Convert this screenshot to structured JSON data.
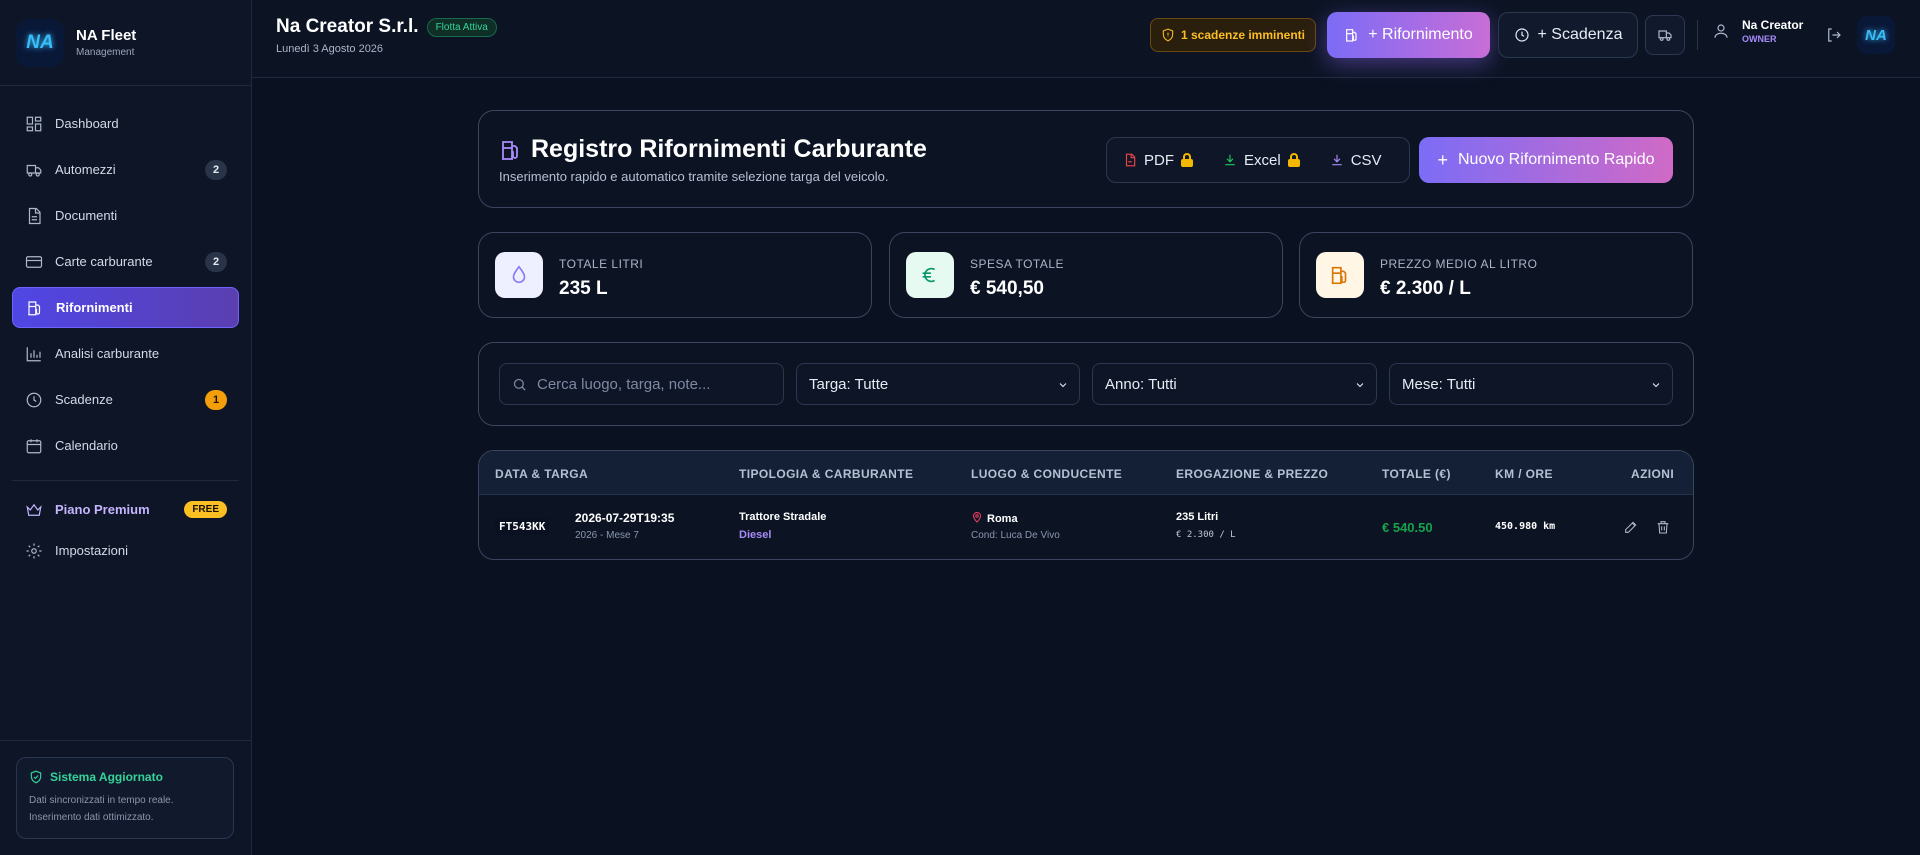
{
  "sidebar": {
    "brand_logo": "NA",
    "brand_title": "NA Fleet",
    "brand_sub": "Management",
    "items": [
      {
        "label": "Dashboard",
        "icon": "dashboard-icon"
      },
      {
        "label": "Automezzi",
        "icon": "truck-icon",
        "badge": "2"
      },
      {
        "label": "Documenti",
        "icon": "document-icon"
      },
      {
        "label": "Carte carburante",
        "icon": "card-icon",
        "badge": "2"
      },
      {
        "label": "Rifornimenti",
        "icon": "fuel-pump-icon",
        "active": true
      },
      {
        "label": "Analisi carburante",
        "icon": "bar-chart-icon"
      },
      {
        "label": "Scadenze",
        "icon": "clock-icon",
        "badge": "1"
      },
      {
        "label": "Calendario",
        "icon": "calendar-icon"
      }
    ],
    "premium_label": "Piano Premium",
    "premium_badge": "FREE",
    "settings_label": "Impostazioni",
    "system_title": "Sistema Aggiornato",
    "system_line1": "Dati sincronizzati in tempo reale.",
    "system_line2": "Inserimento dati ottimizzato."
  },
  "header": {
    "company": "Na Creator S.r.l.",
    "status": "Flotta Attiva",
    "date": "Lunedì 3 Agosto 2026",
    "warning": "1 scadenze imminenti",
    "refuel_button": "+ Rifornimento",
    "deadline_button": "+ Scadenza",
    "user_name": "Na Creator",
    "user_role": "OWNER",
    "avatar_logo": "NA"
  },
  "page": {
    "title": "Registro Rifornimenti Carburante",
    "subtitle": "Inserimento rapido e automatico tramite selezione targa del veicolo.",
    "export_pdf": "PDF",
    "export_excel": "Excel",
    "export_csv": "CSV",
    "new_button": "Nuovo Rifornimento Rapido",
    "new_button_plus": "+"
  },
  "stats": [
    {
      "label": "TOTALE LITRI",
      "value": "235 L"
    },
    {
      "label": "SPESA TOTALE",
      "value": "€ 540,50"
    },
    {
      "label": "PREZZO MEDIO AL LITRO",
      "value": "€ 2.300 / L"
    }
  ],
  "filters": {
    "search_placeholder": "Cerca luogo, targa, note...",
    "plate": "Targa: Tutte",
    "year": "Anno: Tutti",
    "month": "Mese: Tutti"
  },
  "table": {
    "headers": [
      "DATA & TARGA",
      "TIPOLOGIA & CARBURANTE",
      "LUOGO & CONDUCENTE",
      "EROGAZIONE & PREZZO",
      "TOTALE (€)",
      "KM / ORE",
      "AZIONI"
    ],
    "rows": [
      {
        "plate": "FT543KK",
        "datetime": "2026-07-29T19:35",
        "period": "2026 - Mese 7",
        "type": "Trattore Stradale",
        "fuel": "Diesel",
        "place": "Roma",
        "driver": "Cond: Luca De Vivo",
        "liters": "235 Litri",
        "price": "€ 2.300 / L",
        "total": "€ 540.50",
        "km": "450.980 km"
      }
    ]
  }
}
